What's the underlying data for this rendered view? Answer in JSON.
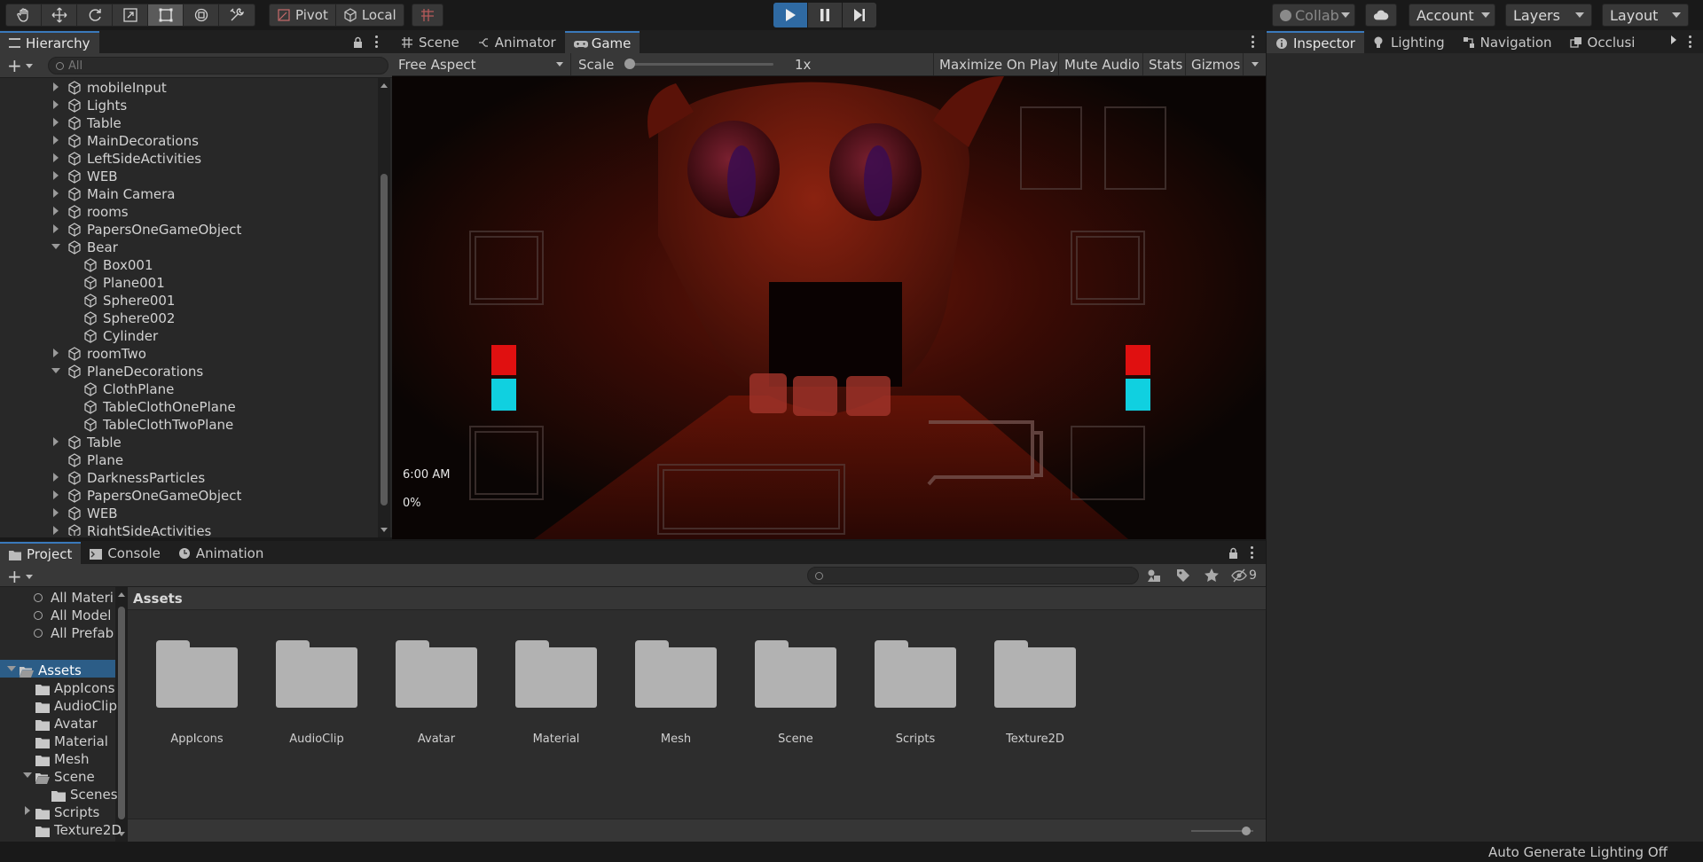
{
  "toolbar": {
    "pivot_label": "Pivot",
    "local_label": "Local",
    "collab_label": "Collab",
    "account_label": "Account",
    "layers_label": "Layers",
    "layout_label": "Layout"
  },
  "hierarchy": {
    "tab_label": "Hierarchy",
    "search_placeholder": "All",
    "items": [
      {
        "label": "mobileInput",
        "indent": 0,
        "state": "collapsed"
      },
      {
        "label": "Lights",
        "indent": 0,
        "state": "collapsed"
      },
      {
        "label": "Table",
        "indent": 0,
        "state": "collapsed"
      },
      {
        "label": "MainDecorations",
        "indent": 0,
        "state": "collapsed"
      },
      {
        "label": "LeftSideActivities",
        "indent": 0,
        "state": "collapsed"
      },
      {
        "label": "WEB",
        "indent": 0,
        "state": "collapsed"
      },
      {
        "label": "Main Camera",
        "indent": 0,
        "state": "collapsed"
      },
      {
        "label": "rooms",
        "indent": 0,
        "state": "collapsed"
      },
      {
        "label": "PapersOneGameObject",
        "indent": 0,
        "state": "collapsed"
      },
      {
        "label": "Bear",
        "indent": 0,
        "state": "expanded"
      },
      {
        "label": "Box001",
        "indent": 1,
        "state": "leaf"
      },
      {
        "label": "Plane001",
        "indent": 1,
        "state": "leaf"
      },
      {
        "label": "Sphere001",
        "indent": 1,
        "state": "leaf"
      },
      {
        "label": "Sphere002",
        "indent": 1,
        "state": "leaf"
      },
      {
        "label": "Cylinder",
        "indent": 1,
        "state": "leaf"
      },
      {
        "label": "roomTwo",
        "indent": 0,
        "state": "collapsed"
      },
      {
        "label": "PlaneDecorations",
        "indent": 0,
        "state": "expanded"
      },
      {
        "label": "ClothPlane",
        "indent": 1,
        "state": "leaf"
      },
      {
        "label": "TableClothOnePlane",
        "indent": 1,
        "state": "leaf"
      },
      {
        "label": "TableClothTwoPlane",
        "indent": 1,
        "state": "leaf"
      },
      {
        "label": "Table",
        "indent": 0,
        "state": "collapsed"
      },
      {
        "label": "Plane",
        "indent": 0,
        "state": "leaf"
      },
      {
        "label": "DarknessParticles",
        "indent": 0,
        "state": "collapsed"
      },
      {
        "label": "PapersOneGameObject",
        "indent": 0,
        "state": "collapsed"
      },
      {
        "label": "WEB",
        "indent": 0,
        "state": "collapsed"
      },
      {
        "label": "RightSideActivities",
        "indent": 0,
        "state": "collapsed"
      }
    ]
  },
  "game": {
    "tabs": [
      {
        "label": "Scene",
        "icon": "grid-icon"
      },
      {
        "label": "Animator",
        "icon": "animator-icon"
      },
      {
        "label": "Game",
        "icon": "gamepad-icon"
      }
    ],
    "aspect_label": "Free Aspect",
    "scale_label": "Scale",
    "scale_value": "1x",
    "scale_level": 0,
    "maximize_label": "Maximize On Play",
    "mute_label": "Mute Audio",
    "stats_label": "Stats",
    "gizmos_label": "Gizmos",
    "time_text": "6:00 AM",
    "power_text": "0%"
  },
  "inspector": {
    "tabs": [
      {
        "label": "Inspector",
        "icon": "info-icon"
      },
      {
        "label": "Lighting",
        "icon": "bulb-icon"
      },
      {
        "label": "Navigation",
        "icon": "nav-icon"
      },
      {
        "label": "Occlusi",
        "icon": "occlusion-icon"
      }
    ]
  },
  "project": {
    "tabs": [
      {
        "label": "Project",
        "icon": "folder-icon"
      },
      {
        "label": "Console",
        "icon": "console-icon"
      },
      {
        "label": "Animation",
        "icon": "clock-icon"
      }
    ],
    "hidden_count": "9",
    "breadcrumb": "Assets",
    "favorites": [
      "All Materi",
      "All Model",
      "All Prefab"
    ],
    "tree": [
      {
        "label": "Assets",
        "indent": 0,
        "state": "expanded",
        "selected": true
      },
      {
        "label": "AppIcons",
        "indent": 1,
        "state": "leaf",
        "selected": false
      },
      {
        "label": "AudioClip",
        "indent": 1,
        "state": "leaf",
        "selected": false
      },
      {
        "label": "Avatar",
        "indent": 1,
        "state": "leaf",
        "selected": false
      },
      {
        "label": "Material",
        "indent": 1,
        "state": "leaf",
        "selected": false
      },
      {
        "label": "Mesh",
        "indent": 1,
        "state": "leaf",
        "selected": false
      },
      {
        "label": "Scene",
        "indent": 1,
        "state": "expanded",
        "selected": false
      },
      {
        "label": "Scenes",
        "indent": 2,
        "state": "leaf",
        "selected": false
      },
      {
        "label": "Scripts",
        "indent": 1,
        "state": "collapsed",
        "selected": false
      },
      {
        "label": "Texture2D",
        "indent": 1,
        "state": "leaf",
        "selected": false
      }
    ],
    "folders": [
      "AppIcons",
      "AudioClip",
      "Avatar",
      "Material",
      "Mesh",
      "Scene",
      "Scripts",
      "Texture2D"
    ],
    "zoom_level": 0.95
  },
  "status": {
    "text": "Auto Generate Lighting Off"
  },
  "colors": {
    "accent": "#3a79bb",
    "selection": "#2c5d87",
    "play_active": "#2f6aa3",
    "panel_bg": "#282828"
  }
}
